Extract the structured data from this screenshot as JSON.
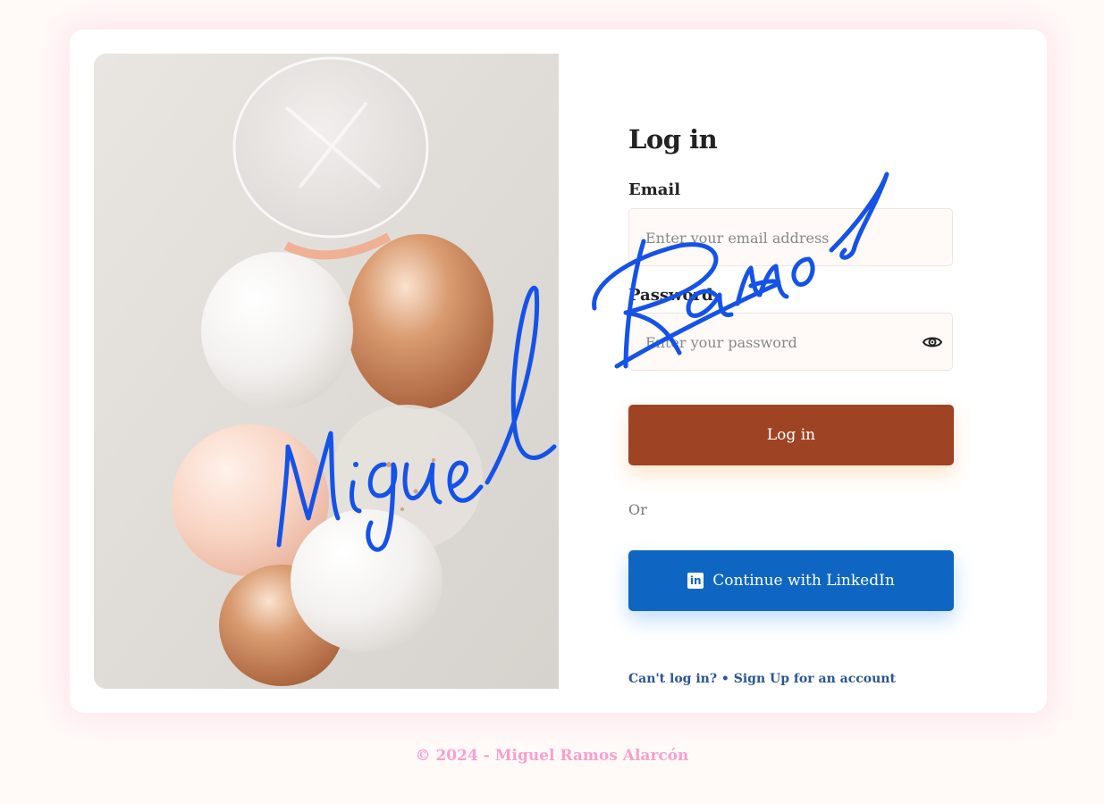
{
  "form": {
    "title": "Log in",
    "email_label": "Email",
    "email_placeholder": "Enter your email address",
    "password_label": "Password",
    "password_placeholder": "Enter your password",
    "login_button": "Log in",
    "or_text": "Or",
    "linkedin_button": "Continue with LinkedIn",
    "linkedin_icon": "in",
    "cant_login": "Can't log in?",
    "separator": " • ",
    "signup": "Sign Up for an account"
  },
  "footer": {
    "text": "© 2024 - Miguel Ramos Alarcón"
  },
  "icons": {
    "eye": "eye-icon",
    "linkedin": "linkedin-icon"
  },
  "colors": {
    "login_button": "#9e4424",
    "linkedin_button": "#0f66c2",
    "signature": "#1552e8",
    "footer": "#f7a0cd",
    "link": "#2b5593"
  }
}
